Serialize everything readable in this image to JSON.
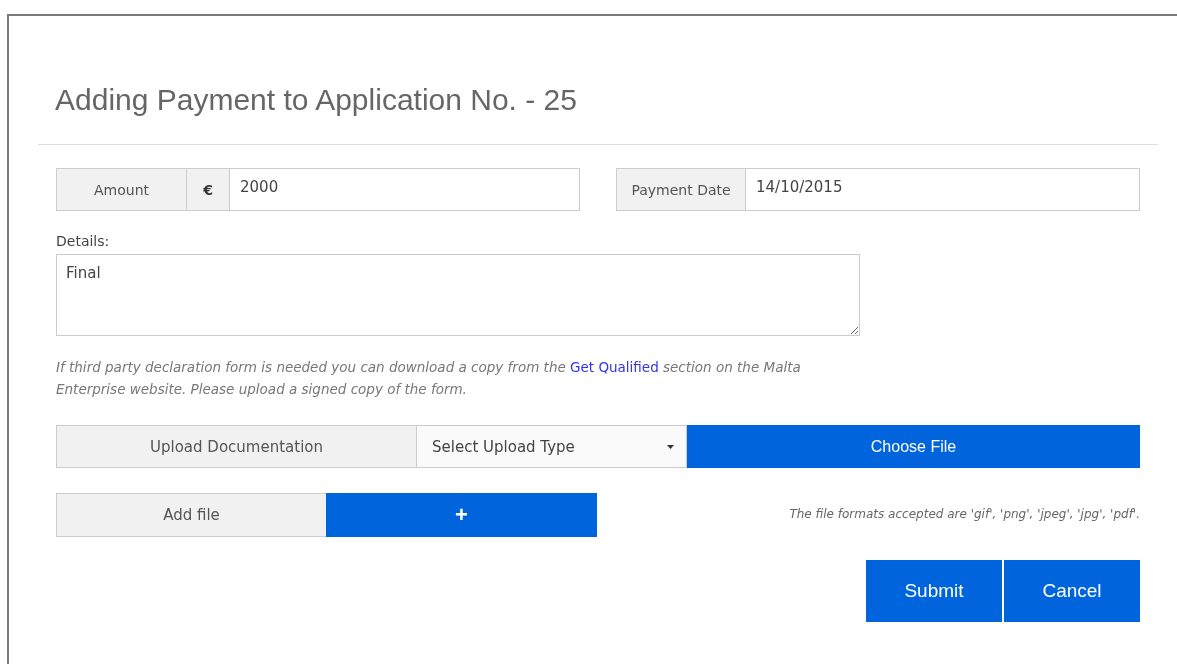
{
  "title": "Adding Payment to Application No. - 25",
  "amount": {
    "label": "Amount",
    "currency": "€",
    "value": "2000"
  },
  "payment_date": {
    "label": "Payment Date",
    "value": "14/10/2015"
  },
  "details": {
    "label": "Details:",
    "value": "Final"
  },
  "note": {
    "before": "If third party declaration form is needed you can download a copy from the ",
    "link": "Get Qualified",
    "after": " section on the Malta Enterprise website. Please upload a signed copy of the form."
  },
  "upload": {
    "label": "Upload Documentation",
    "select": "Select Upload Type",
    "button": "Choose File"
  },
  "add_file": {
    "label": "Add file",
    "button": "+"
  },
  "formats_note": "The file formats accepted are 'gif', 'png', 'jpeg', 'jpg', 'pdf'.",
  "buttons": [
    "Submit",
    "Cancel"
  ]
}
